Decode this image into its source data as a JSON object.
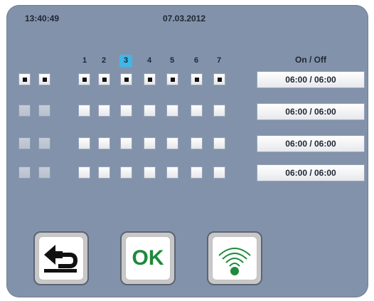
{
  "status": {
    "time": "13:40:49",
    "date": "07.03.2012"
  },
  "days": {
    "labels": [
      "1",
      "2",
      "3",
      "4",
      "5",
      "6",
      "7"
    ],
    "selected": "3"
  },
  "onoff_header": "On / Off",
  "rows": [
    {
      "time_range": "06:00 / 06:00",
      "checked": true
    },
    {
      "time_range": "06:00 / 06:00",
      "checked": false
    },
    {
      "time_range": "06:00 / 06:00",
      "checked": false
    },
    {
      "time_range": "06:00 / 06:00",
      "checked": false
    }
  ],
  "buttons": {
    "back": {
      "icon": "back-arrow-icon"
    },
    "ok": {
      "label": "OK"
    },
    "wireless": {
      "icon": "wifi-icon",
      "color": "#1e8a3c"
    }
  },
  "colors": {
    "panel": "#8392ab",
    "highlight": "#41b6e6",
    "ok_green": "#1e8a3c"
  }
}
